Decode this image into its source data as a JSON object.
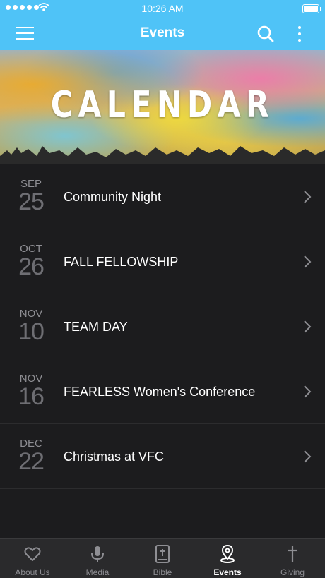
{
  "status": {
    "time": "10:26 AM"
  },
  "header": {
    "title": "Events"
  },
  "banner": {
    "text": "CALENDAR"
  },
  "events": [
    {
      "month": "SEP",
      "day": "25",
      "name": "Community Night"
    },
    {
      "month": "OCT",
      "day": "26",
      "name": "FALL FELLOWSHIP"
    },
    {
      "month": "NOV",
      "day": "10",
      "name": "TEAM DAY"
    },
    {
      "month": "NOV",
      "day": "16",
      "name": "FEARLESS Women's Conference"
    },
    {
      "month": "DEC",
      "day": "22",
      "name": "Christmas at VFC"
    }
  ],
  "tabs": [
    {
      "label": "About Us",
      "icon": "heart-icon"
    },
    {
      "label": "Media",
      "icon": "microphone-icon"
    },
    {
      "label": "Bible",
      "icon": "bible-icon"
    },
    {
      "label": "Events",
      "icon": "location-pin-icon",
      "active": true
    },
    {
      "label": "Giving",
      "icon": "cross-icon"
    }
  ],
  "colors": {
    "accent": "#4fc3f7",
    "background": "#1c1c1e",
    "tabbar": "#2a2a2c"
  }
}
